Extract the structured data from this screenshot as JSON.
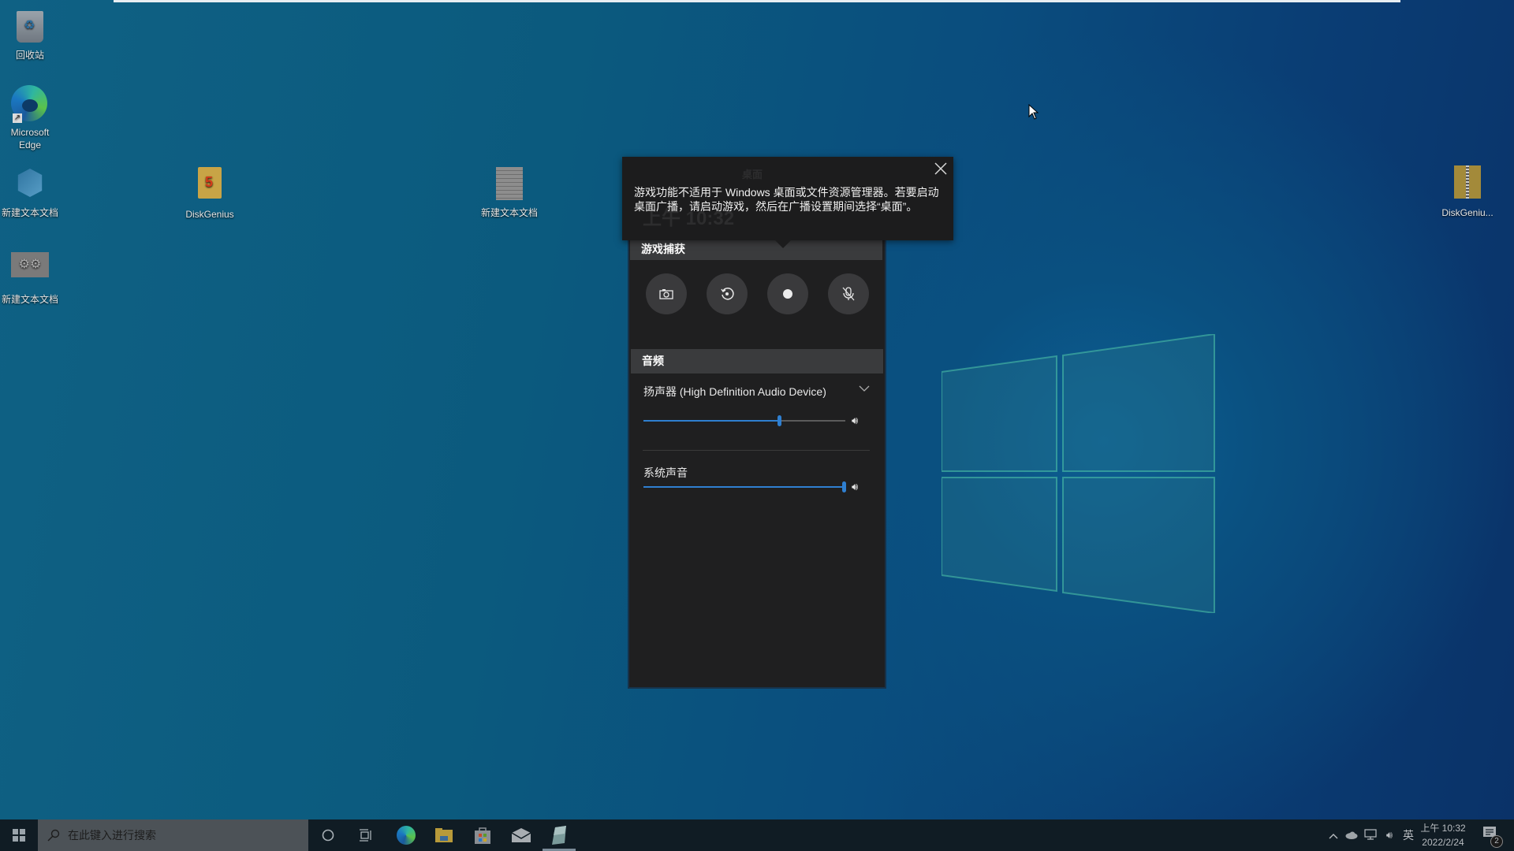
{
  "desktop": {
    "icons": [
      {
        "label": "回收站",
        "icon": "recycle-bin-icon"
      },
      {
        "label": "Microsoft Edge",
        "icon": "edge-icon"
      },
      {
        "label": "新建文本文档",
        "icon": "registry-file-icon"
      },
      {
        "label": "DiskGenius",
        "icon": "diskgenius-icon"
      },
      {
        "label": "新建文本文档",
        "icon": "text-document-icon"
      },
      {
        "label": "新建文本文档",
        "icon": "gears-file-icon"
      },
      {
        "label": "DiskGeniu...",
        "icon": "zip-folder-icon"
      }
    ]
  },
  "tooltip": {
    "message": "游戏功能不适用于 Windows 桌面或文件资源管理器。若要启动桌面广播，请启动游戏，然后在广播设置期间选择“桌面”。",
    "ghost_title": "桌面",
    "ghost_time": "上午 10:32",
    "close_icon": "close-icon"
  },
  "game_bar": {
    "capture_section": {
      "title": "游戏捕获",
      "buttons": [
        {
          "name": "screenshot",
          "icon": "camera-icon"
        },
        {
          "name": "record-last",
          "icon": "replay-icon"
        },
        {
          "name": "start-recording",
          "icon": "record-icon"
        },
        {
          "name": "microphone",
          "icon": "mic-off-icon"
        }
      ]
    },
    "audio_section": {
      "title": "音频",
      "device_label": "扬声器 (High Definition Audio Device)",
      "device_volume": 0.67,
      "system_sound_label": "系统声音",
      "system_sound_volume": 1.0
    }
  },
  "taskbar": {
    "search_placeholder": "在此键入进行搜索",
    "pinned": [
      "cortana-icon",
      "task-view-icon",
      "edge-icon",
      "file-explorer-icon",
      "store-icon",
      "mail-icon",
      "app-icon"
    ],
    "tray": {
      "ime": "英",
      "time": "上午 10:32",
      "date": "2022/2/24",
      "notification_count": "2"
    }
  },
  "colors": {
    "accent": "#2f7fd0",
    "panel_bg": "#1f1f20",
    "section_bg": "#3a3b3d",
    "taskbar_bg": "#101c24"
  }
}
